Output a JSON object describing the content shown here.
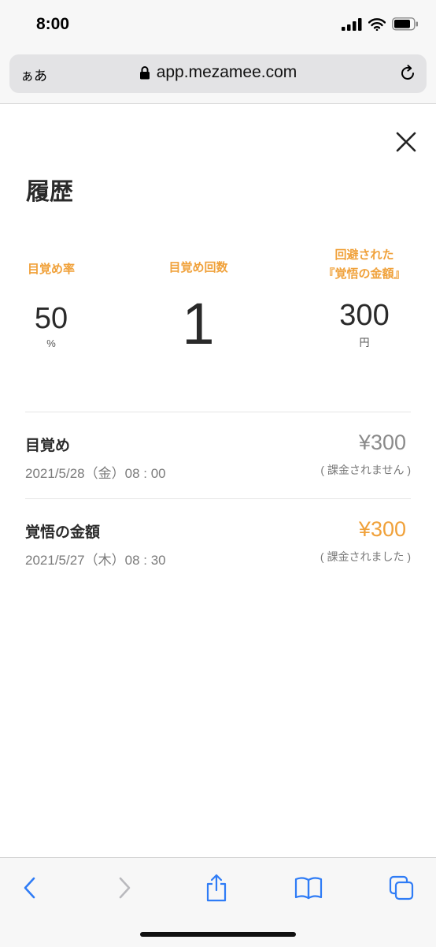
{
  "status_bar": {
    "time": "8:00"
  },
  "browser": {
    "aa_label": "ぁあ",
    "url": "app.mezamee.com"
  },
  "page": {
    "title": "履歴"
  },
  "stats": {
    "wake_rate": {
      "label": "目覚め率",
      "value": "50",
      "unit": "%"
    },
    "wake_count": {
      "label": "目覚め回数",
      "value": "1"
    },
    "avoided": {
      "label_line1": "回避された",
      "label_line2": "『覚悟の金額』",
      "value": "300",
      "unit": "円"
    }
  },
  "history": [
    {
      "title": "目覚め",
      "date": "2021/5/28（金）08 : 00",
      "amount": "¥300",
      "note": "( 課金されません )",
      "amount_color": "#8a8a8a"
    },
    {
      "title": "覚悟の金額",
      "date": "2021/5/27（木）08 : 30",
      "amount": "¥300",
      "note": "( 課金されました )",
      "amount_color": "#f0a13a"
    }
  ],
  "colors": {
    "accent": "#f0a13a",
    "link_blue": "#2f7cf6",
    "disabled_gray": "#b9b9bd"
  }
}
